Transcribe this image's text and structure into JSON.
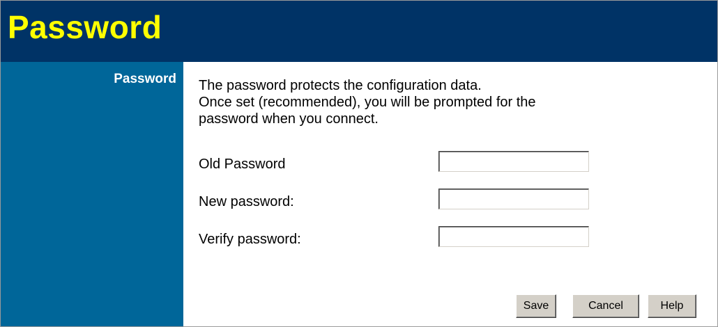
{
  "header": {
    "title": "Password"
  },
  "sidebar": {
    "label": "Password"
  },
  "main": {
    "description": [
      "The password protects the configuration data.",
      "Once set (recommended), you will be prompted for the",
      "password when you connect."
    ],
    "fields": {
      "old": {
        "label": "Old Password",
        "value": ""
      },
      "new": {
        "label": "New password:",
        "value": ""
      },
      "verify": {
        "label": "Verify password:",
        "value": ""
      }
    }
  },
  "buttons": {
    "save": "Save",
    "cancel": "Cancel",
    "help": "Help"
  },
  "colors": {
    "header_bg": "#003366",
    "header_title": "#ffff00",
    "sidebar_bg": "#006699",
    "sidebar_text": "#ffffff",
    "button_face": "#d4d0c8"
  }
}
